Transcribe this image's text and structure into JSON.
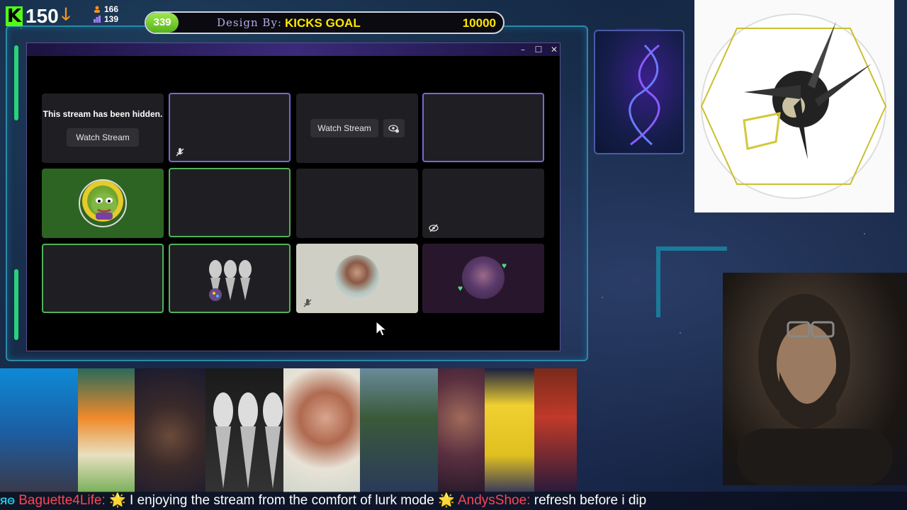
{
  "hud": {
    "kick_count": "150",
    "stat_followers": "166",
    "stat_subs": "139"
  },
  "goal": {
    "current": "339",
    "design_label": "Design By:",
    "title": "KICKS GOAL",
    "target": "10000",
    "progress_fraction": 0.034
  },
  "window": {
    "title_buttons": {
      "minimize": "–",
      "maximize": "☐",
      "close": "✕"
    },
    "hidden_text": "This stream has been hidden.",
    "watch_label_1": "Watch Stream",
    "watch_label_2": "Watch Stream"
  },
  "ticker": {
    "badge": "ЯΘ",
    "user1": "Baguette4Life:",
    "msg1": "I enjoying the stream from the comfort of lurk mode",
    "user2": "AndysShoe:",
    "msg2": "refresh before i dip"
  },
  "colors": {
    "kick_green": "#53fc18",
    "goal_yellow": "#ffe600",
    "tile_purple_border": "#7568d8",
    "tile_green_border": "#52b15a"
  }
}
